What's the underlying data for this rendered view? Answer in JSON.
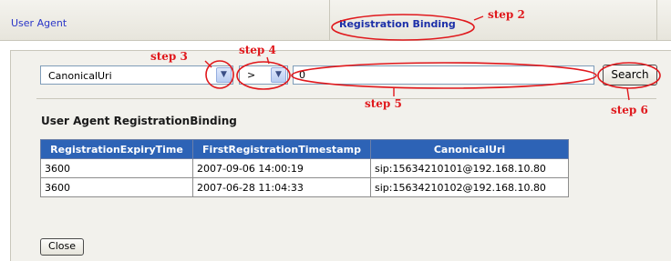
{
  "tabs": [
    {
      "label": "User Agent"
    },
    {
      "label": "Registration Binding"
    }
  ],
  "filter": {
    "field_value": "CanonicalUri",
    "operator_value": ">",
    "search_value": "0",
    "search_label": "Search"
  },
  "section_title": "User Agent RegistrationBinding",
  "table": {
    "headers": [
      "RegistrationExpiryTime",
      "FirstRegistrationTimestamp",
      "CanonicalUri"
    ],
    "rows": [
      [
        "3600",
        "2007-09-06 14:00:19",
        "sip:15634210101@192.168.10.80"
      ],
      [
        "3600",
        "2007-06-28 11:04:33",
        "sip:15634210102@192.168.10.80"
      ]
    ]
  },
  "close_label": "Close",
  "annotations": {
    "step2": "step 2",
    "step3": "step 3",
    "step4": "step 4",
    "step5": "step 5",
    "step6": "step 6",
    "color": "#e0181c"
  }
}
